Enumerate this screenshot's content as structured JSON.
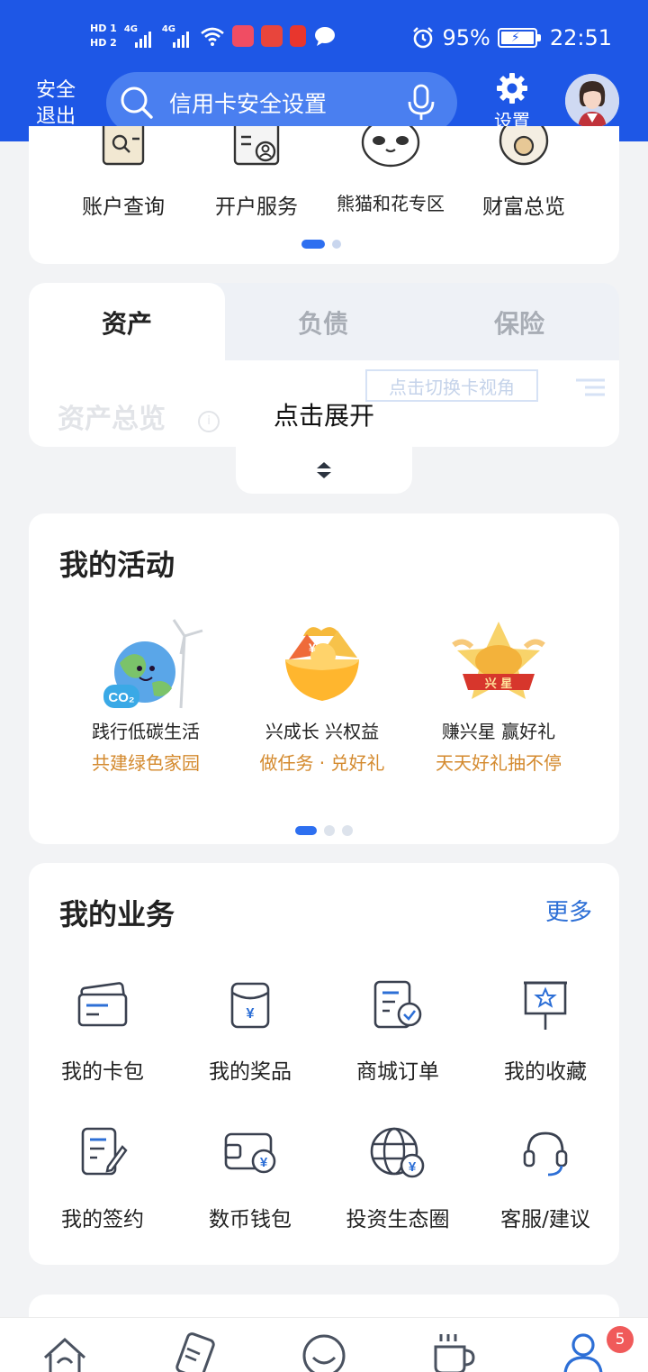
{
  "status_bar": {
    "hd1": "HD 1",
    "hd2": "HD 2",
    "signal1_gen": "4G",
    "signal2_gen": "4G",
    "battery_percent": "95%",
    "time": "22:51"
  },
  "header": {
    "safe_exit_line1": "安全",
    "safe_exit_line2": "退出",
    "search_text": "信用卡安全设置",
    "settings_label": "设置",
    "bg_color": "#1e57e6"
  },
  "quick_menu": {
    "items": [
      {
        "label": "账户查询",
        "icon": "account-query-icon"
      },
      {
        "label": "开户服务",
        "icon": "account-open-icon"
      },
      {
        "label": "熊猫和花专区",
        "icon": "panda-icon"
      },
      {
        "label": "财富总览",
        "icon": "wealth-overview-icon"
      }
    ],
    "page_count": 2,
    "active_page": 1
  },
  "assets": {
    "tabs": [
      "资产",
      "负债",
      "保险"
    ],
    "active_tab": "资产",
    "overview_title": "资产总览",
    "switch_view": "点击切换卡视角",
    "expand_text": "点击展开"
  },
  "activities": {
    "title": "我的活动",
    "items": [
      {
        "title": "践行低碳生活",
        "subtitle": "共建绿色家园",
        "icon": "earth-co2-icon"
      },
      {
        "title": "兴成长 兴权益",
        "subtitle": "做任务 · 兑好礼",
        "icon": "gift-bowl-icon"
      },
      {
        "title": "赚兴星 赢好礼",
        "subtitle": "天天好礼抽不停",
        "icon": "star-badge-icon"
      }
    ],
    "page_count": 3,
    "active_page": 1,
    "subtitle_color": "#d48a2e"
  },
  "business": {
    "title": "我的业务",
    "more": "更多",
    "items": [
      {
        "label": "我的卡包",
        "icon": "card-wallet-icon"
      },
      {
        "label": "我的奖品",
        "icon": "prize-icon"
      },
      {
        "label": "商城订单",
        "icon": "order-icon"
      },
      {
        "label": "我的收藏",
        "icon": "favorite-icon"
      },
      {
        "label": "我的签约",
        "icon": "contract-icon"
      },
      {
        "label": "数币钱包",
        "icon": "digital-wallet-icon"
      },
      {
        "label": "投资生态圈",
        "icon": "globe-yuan-icon"
      },
      {
        "label": "客服/建议",
        "icon": "headset-icon"
      }
    ]
  },
  "bottom_nav": {
    "items": [
      "home-icon",
      "card-icon",
      "smile-icon",
      "cup-icon",
      "profile-icon"
    ],
    "active": "profile-icon",
    "badge": "5"
  }
}
